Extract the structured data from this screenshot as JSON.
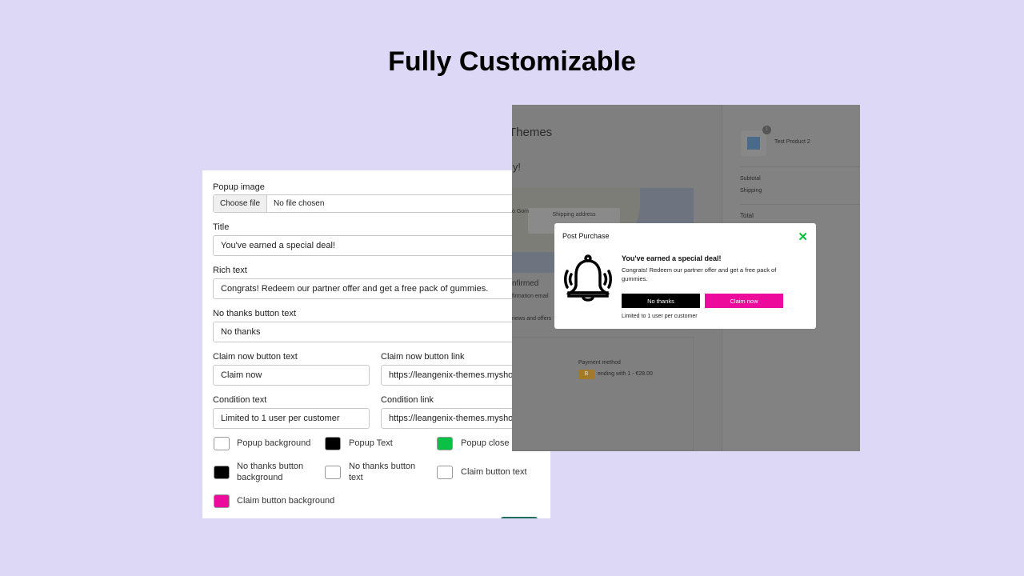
{
  "headline": "Fully Customizable",
  "form": {
    "popup_image_label": "Popup image",
    "choose_file": "Choose file",
    "no_file": "No file chosen",
    "title_label": "Title",
    "title_value": "You've earned a special deal!",
    "rich_label": "Rich text",
    "rich_value": "Congrats! Redeem our partner offer and get a free pack of gummies.",
    "no_thanks_label": "No thanks button text",
    "no_thanks_value": "No thanks",
    "claim_label": "Claim now button text",
    "claim_value": "Claim now",
    "claim_link_label": "Claim now button link",
    "claim_link_value": "https://leangenix-themes.myshopify.com",
    "condition_label": "Condition text",
    "condition_value": "Limited to 1 user per customer",
    "condition_link_label": "Condition link",
    "condition_link_value": "https://leangenix-themes.myshopify.com",
    "colors": [
      {
        "label": "Popup background",
        "color": "#ffffff"
      },
      {
        "label": "Popup Text",
        "color": "#000000"
      },
      {
        "label": "Popup close icon",
        "color": "#0ac146"
      },
      {
        "label": "No thanks button background",
        "color": "#000000"
      },
      {
        "label": "No thanks button text",
        "color": "#ffffff"
      },
      {
        "label": "Claim button text",
        "color": "#ffffff"
      },
      {
        "label": "Claim button background",
        "color": "#ec0b9a"
      }
    ]
  },
  "preview": {
    "store_title": "Themes",
    "thanks": "ly!",
    "shipping_address": "Shipping address",
    "map_place": "o Gom",
    "confirmed": "nfirmed",
    "confirm_email": "firmation email",
    "news": "news and offers",
    "payment_method": "Payment method",
    "payment_badge": "B",
    "payment_detail": "ending with 1 - €28.00",
    "product_qty": "1",
    "product_name": "Test Product 2",
    "subtotal": "Subtotal",
    "shipping": "Shipping",
    "total": "Total",
    "popup": {
      "header": "Post Purchase",
      "title": "You've earned a special deal!",
      "body": "Congrats! Redeem our partner offer and get a free pack of gummies.",
      "no_thanks": "No thanks",
      "claim": "Claim now",
      "condition": "Limited to 1 user per customer",
      "icon": "bell-ringing-icon"
    }
  }
}
